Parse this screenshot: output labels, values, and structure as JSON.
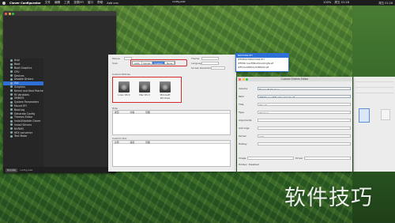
{
  "menubar": {
    "app": "Clover Configurator",
    "items": [
      "文件",
      "编辑",
      "工具",
      "挂载EFI",
      "窗口",
      "帮助",
      "Add ons"
    ],
    "right": [
      "100%",
      "周五 01:28"
    ]
  },
  "window_title": "config.plist",
  "clover_window": {
    "title": "Clover Configurator",
    "sidebar": [
      "Acpi",
      "Boot",
      "Boot Graphics",
      "CPU",
      "Devices",
      "Disable Drivers",
      "Gui",
      "Graphics",
      "Kernel and Kext Patches",
      "Rt Variables",
      "SMBIOS",
      "System Parameters",
      "Mount EFI",
      "Boot.log",
      "Generate Config",
      "Themes Editor",
      "Install/Update Clover",
      "Install Drivers",
      "NVRAM",
      "HEX converter",
      "Text Mode"
    ],
    "selected_index": 6,
    "footer": [
      "Donate",
      "config.plist"
    ]
  },
  "gui_panel": {
    "labels": {
      "mouse": "Mouse",
      "scan": "Scan",
      "hide": "Hide",
      "custom_entries": "Custom Entries",
      "legacy": "Custom Legacy",
      "tool": "Custom Tool",
      "theme": "Theme",
      "language": "Language",
      "screen": "Screen Resolution"
    },
    "segments": [
      "Auto",
      "Kernel",
      "Custom",
      "None"
    ],
    "selected_segment": 2,
    "disks": [
      "Linux OS X",
      "Mac OS X",
      "Microsoft Windows"
    ],
    "table_headers": [
      "类型",
      "内容",
      "隐藏"
    ],
    "table2_headers": [
      "名称",
      "路径",
      "隐藏"
    ]
  },
  "popup": {
    "items": [
      "BOOTX64.EFI",
      "\\EFI\\BOOT\\BOOTX64.EFI",
      "\\EFI\\Microsoft\\Boot\\bootmgfw.efi",
      "\\EFI\\CLOVER\\CLOVERX64.efi"
    ],
    "highlighted": 0
  },
  "custom_editor": {
    "title": "Custom Entries Editor",
    "rows": [
      {
        "label": "Volume",
        "value": "Microsoft Windows"
      },
      {
        "label": "Path",
        "value": "\\EFI\\Microsoft\\Boot\\bootmgfw.efi"
      },
      {
        "label": "Title",
        "value": "Win 10"
      },
      {
        "label": "Type",
        "value": "Windows"
      },
      {
        "label": "Arguments",
        "value": ""
      },
      {
        "label": "Add Args",
        "value": ""
      },
      {
        "label": "Kernel",
        "value": "Auto"
      },
      {
        "label": "Hotkey",
        "value": ""
      }
    ],
    "footer_labels": [
      "Image",
      "Driver",
      "Hidden",
      "Disabled"
    ]
  },
  "watermark": "软件技巧"
}
